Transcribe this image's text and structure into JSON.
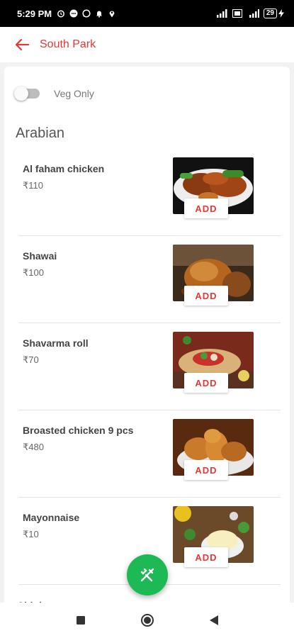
{
  "status_bar": {
    "time": "5:29 PM",
    "battery": "29"
  },
  "header": {
    "title": "South Park"
  },
  "filter": {
    "veg_only_label": "Veg Only",
    "veg_only_enabled": false
  },
  "section": {
    "title": "Arabian"
  },
  "items": [
    {
      "name": "Al faham chicken",
      "price": "₹110",
      "add_label": "ADD"
    },
    {
      "name": "Shawai",
      "price": "₹100",
      "add_label": "ADD"
    },
    {
      "name": "Shavarma roll",
      "price": "₹70",
      "add_label": "ADD"
    },
    {
      "name": "Broasted chicken 9 pcs",
      "price": "₹480",
      "add_label": "ADD"
    },
    {
      "name": "Mayonnaise",
      "price": "₹10",
      "add_label": "ADD"
    }
  ],
  "next_section_partial": "Chinh",
  "colors": {
    "accent": "#e53935",
    "fab": "#1db954"
  },
  "icons": {
    "back": "arrow-left-icon",
    "fab": "fork-knife-icon",
    "nav_recent": "square-icon",
    "nav_home": "circle-icon",
    "nav_back": "triangle-back-icon"
  }
}
